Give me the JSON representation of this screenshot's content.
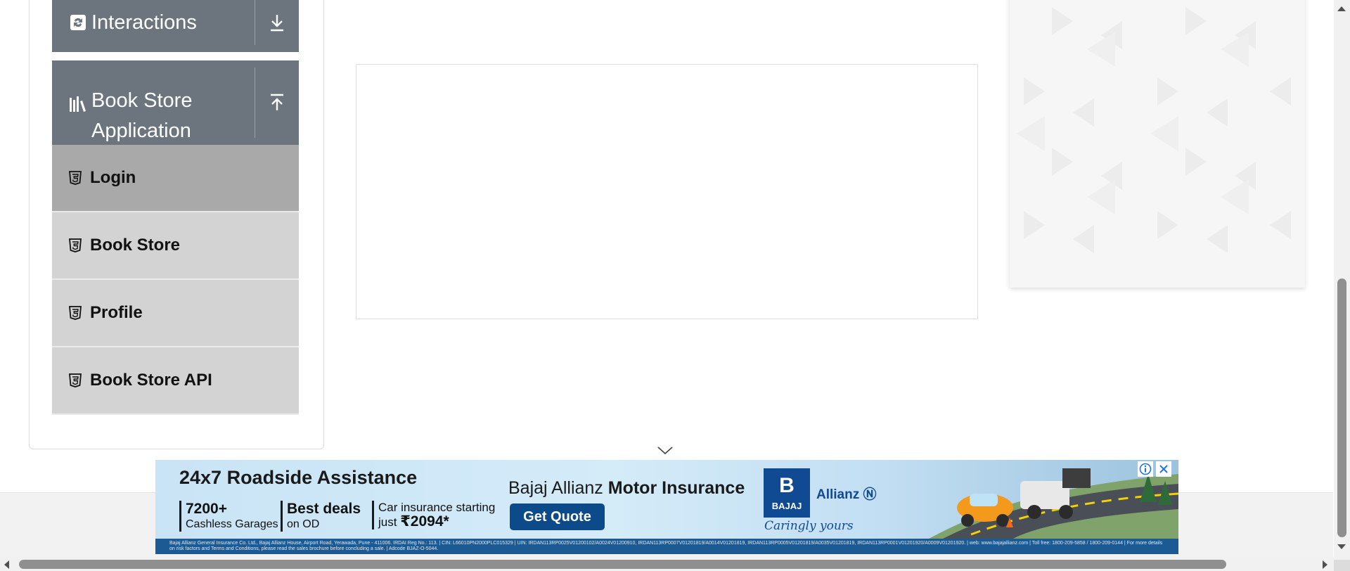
{
  "sidebar": {
    "groups": [
      {
        "label": "Interactions",
        "icon": "interactions-icon",
        "toggle_icon": "expand-down-icon"
      },
      {
        "label_line1": "Book Store",
        "label_line2": "Application",
        "icon": "bookshelf-icon",
        "toggle_icon": "collapse-up-icon"
      }
    ],
    "items": [
      {
        "label": "Login",
        "icon": "html5-icon",
        "active": true
      },
      {
        "label": "Book Store",
        "icon": "html5-icon",
        "active": false
      },
      {
        "label": "Profile",
        "icon": "html5-icon",
        "active": false
      },
      {
        "label": "Book Store API",
        "icon": "html5-icon",
        "active": false
      }
    ]
  },
  "ad": {
    "headline": "24x7 Roadside Assistance",
    "stats": [
      {
        "big": "7200+",
        "small": "Cashless Garages"
      },
      {
        "big": "Best deals",
        "small": "on OD"
      },
      {
        "line1": "Car insurance starting",
        "prefix": "just ",
        "price": "₹2094*"
      }
    ],
    "brand_regular": "Bajaj Allianz ",
    "brand_bold": "Motor Insurance",
    "cta": "Get Quote",
    "logo_mark": "B",
    "logo_word": "BAJAJ",
    "partner": "Allianz",
    "tagline": "Caringly yours",
    "fineprint": "Bajaj Allianz General Insurance Co. Ltd., Bajaj Allianz House, Airport Road, Yerawada, Pune - 411006. IRDAI Reg No.: 113. | CIN: L66010PN2000PLC015329 | UIN: IRDAN113RP0025V01200102/A0024V01200910, IRDAN113RP0007V01201819/A0014V01201819, IRDAN113RP0005V01201819/A0035V01201819, IRDAN113RP0001V01201920/A0009V01201920. | web: www.bajajallianz.com | Toll free: 1800-209-5858 / 1800-209-0144 | For more details on risk factors and Terms and Conditions, please read the sales brochure before concluding a sale. | Adcode BJAZ-O-5044."
  },
  "colors": {
    "group_header_bg": "#6c757d",
    "item_bg": "#d3d3d3",
    "item_active_bg": "#a9a9a9",
    "ad_button": "#0d4a8a"
  }
}
